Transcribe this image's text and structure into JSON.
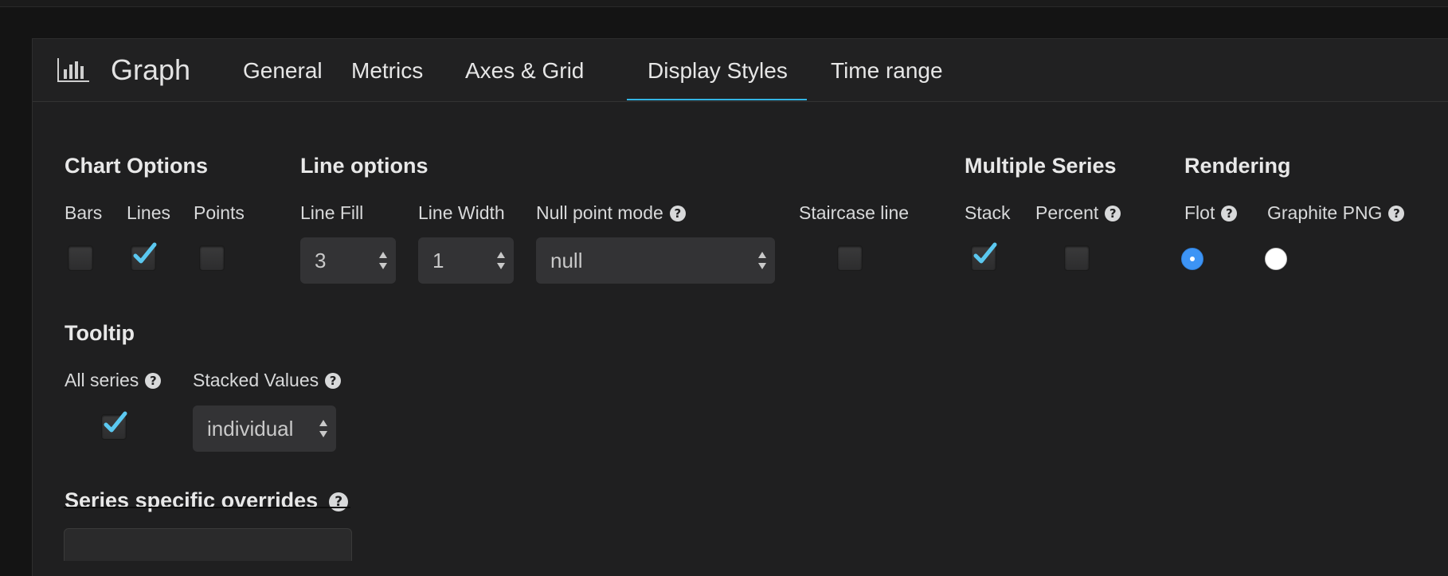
{
  "panel": {
    "title": "Graph",
    "icon": "bar-chart-icon"
  },
  "tabs": [
    {
      "label": "General",
      "active": false
    },
    {
      "label": "Metrics",
      "active": false
    },
    {
      "label": "Axes & Grid",
      "active": false
    },
    {
      "label": "Display Styles",
      "active": true
    },
    {
      "label": "Time range",
      "active": false
    }
  ],
  "chart_options": {
    "title": "Chart Options",
    "bars": {
      "label": "Bars",
      "checked": false
    },
    "lines": {
      "label": "Lines",
      "checked": true
    },
    "points": {
      "label": "Points",
      "checked": false
    }
  },
  "line_options": {
    "title": "Line options",
    "line_fill": {
      "label": "Line Fill",
      "value": "3"
    },
    "line_width": {
      "label": "Line Width",
      "value": "1"
    },
    "null_point_mode": {
      "label": "Null point mode",
      "value": "null"
    },
    "staircase": {
      "label": "Staircase line",
      "checked": false
    }
  },
  "multiple_series": {
    "title": "Multiple Series",
    "stack": {
      "label": "Stack",
      "checked": true
    },
    "percent": {
      "label": "Percent",
      "checked": false
    }
  },
  "rendering": {
    "title": "Rendering",
    "flot": {
      "label": "Flot",
      "selected": true
    },
    "graphite_png": {
      "label": "Graphite PNG",
      "selected": false
    }
  },
  "tooltip": {
    "title": "Tooltip",
    "all_series": {
      "label": "All series",
      "checked": true
    },
    "stacked_values": {
      "label": "Stacked Values",
      "value": "individual"
    }
  },
  "overrides": {
    "title": "Series specific overrides"
  },
  "colors": {
    "accent": "#33b5e5",
    "check": "#5bc8f0",
    "radio_selected": "#3d94f5"
  }
}
